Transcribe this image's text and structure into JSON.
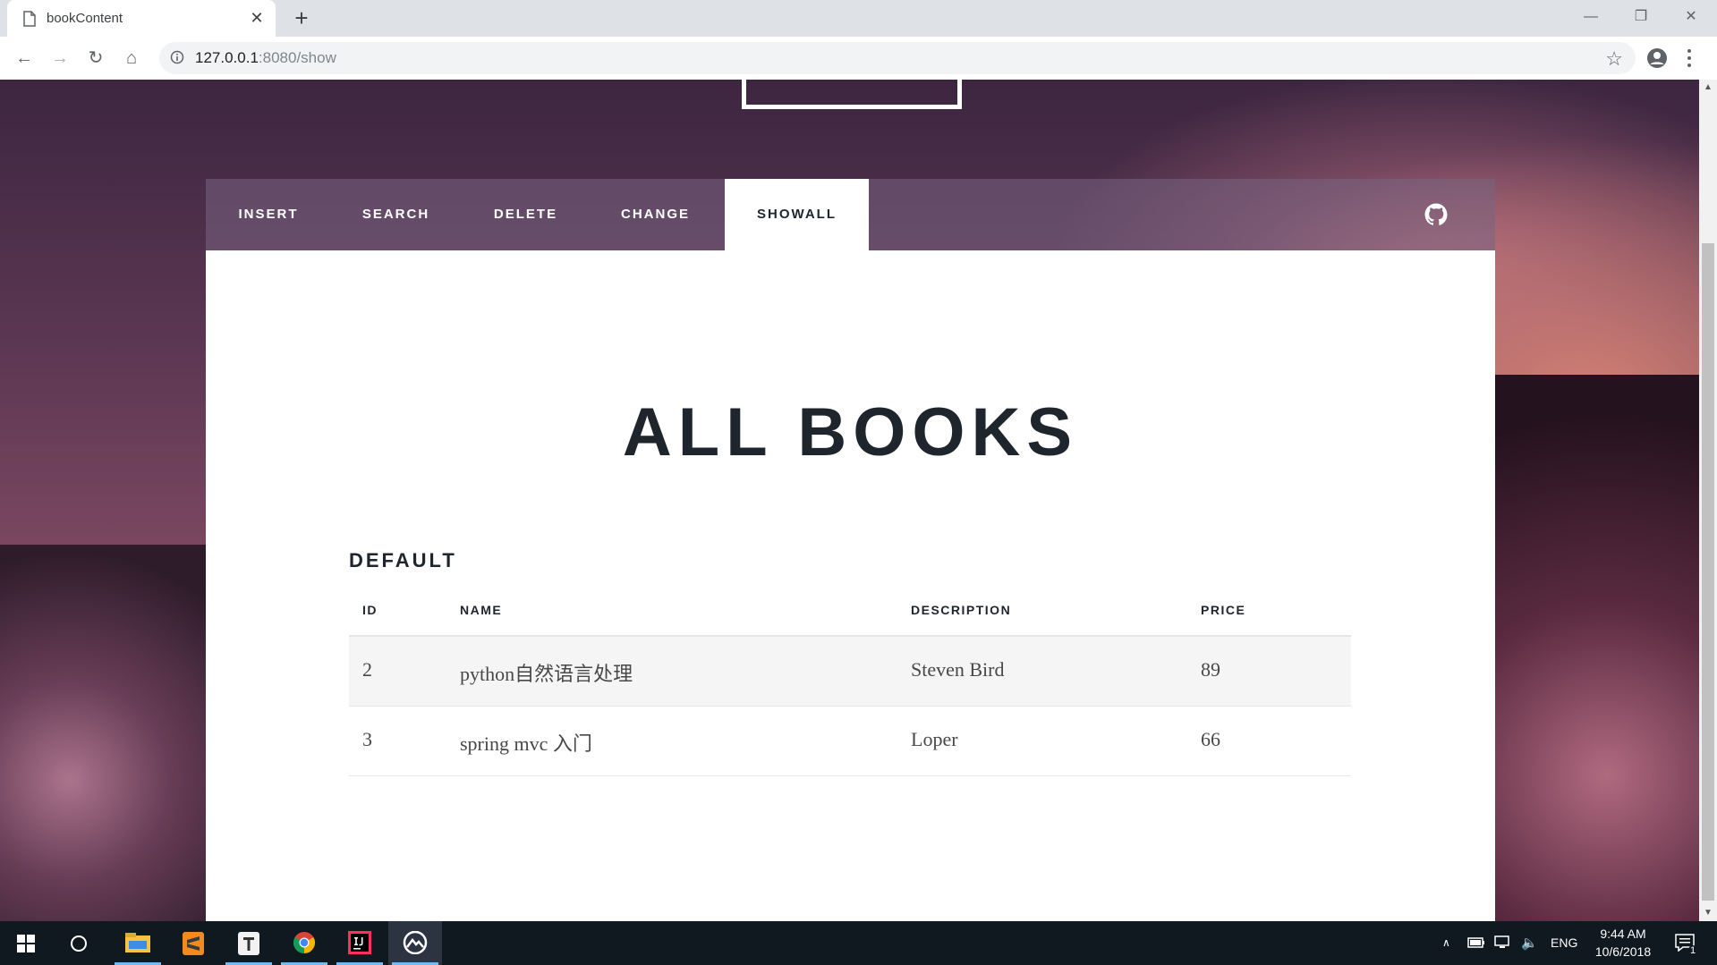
{
  "browser": {
    "tab_title": "bookContent",
    "tab_close": "✕",
    "new_tab": "+",
    "url_host": "127.0.0.1",
    "url_rest": ":8080/show",
    "star": "☆"
  },
  "nav": {
    "items": [
      {
        "label": "INSERT"
      },
      {
        "label": "SEARCH"
      },
      {
        "label": "DELETE"
      },
      {
        "label": "CHANGE"
      },
      {
        "label": "SHOWALL",
        "active": true
      }
    ]
  },
  "main": {
    "title": "ALL BOOKS",
    "section_title": "DEFAULT",
    "table": {
      "headers": [
        "ID",
        "NAME",
        "DESCRIPTION",
        "PRICE"
      ],
      "rows": [
        [
          "2",
          "python自然语言处理",
          "Steven Bird",
          "89"
        ],
        [
          "3",
          "spring mvc 入门",
          "Loper",
          "66"
        ]
      ]
    }
  },
  "taskbar": {
    "language": "ENG",
    "time": "9:44 AM",
    "date": "10/6/2018",
    "notifications": "1"
  }
}
